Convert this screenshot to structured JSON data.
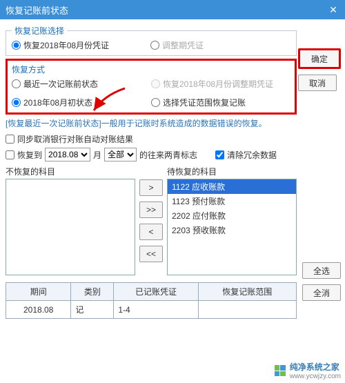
{
  "titlebar": {
    "title": "恢复记账前状态"
  },
  "section_select": {
    "legend": "恢复记账选择",
    "opt1": "恢复2018年08月份凭证",
    "opt2": "调整期凭证"
  },
  "section_method": {
    "legend": "恢复方式",
    "opt1": "最近一次记账前状态",
    "opt2": "恢复2018年08月份调整期凭证",
    "opt3": "2018年08月初状态",
    "opt4": "选择凭证范围恢复记账"
  },
  "desc": "[恢复最近一次记账前状态]一般用于记账时系统造成的数据错误的恢复。",
  "sync_label": "同步取消银行对账自动对账结果",
  "restore_to": "恢复到",
  "month_suffix": "月",
  "period_value": "2018.08",
  "all_value": "全部",
  "round_label": "的往来两青标志",
  "clear_label": "清除冗余数据",
  "left_list_label": "不恢复的科目",
  "right_list_label": "待恢复的科目",
  "right_items": [
    {
      "code": "1122",
      "name": "应收账款",
      "selected": true
    },
    {
      "code": "1123",
      "name": "预付账款",
      "selected": false
    },
    {
      "code": "2202",
      "name": "应付账款",
      "selected": false
    },
    {
      "code": "2203",
      "name": "预收账款",
      "selected": false
    }
  ],
  "transfer": {
    "r": ">",
    "rr": ">>",
    "l": "<",
    "ll": "<<"
  },
  "table": {
    "headers": [
      "期间",
      "类别",
      "已记账凭证",
      "恢复记账范围"
    ],
    "rows": [
      {
        "period": "2018.08",
        "cat": "记",
        "posted": "1-4",
        "range": ""
      }
    ]
  },
  "buttons": {
    "ok": "确定",
    "cancel": "取消",
    "select_all": "全选",
    "clear_all": "全消"
  },
  "watermark": {
    "name": "纯净系统之家",
    "url": "www.ycwjzy.com"
  }
}
